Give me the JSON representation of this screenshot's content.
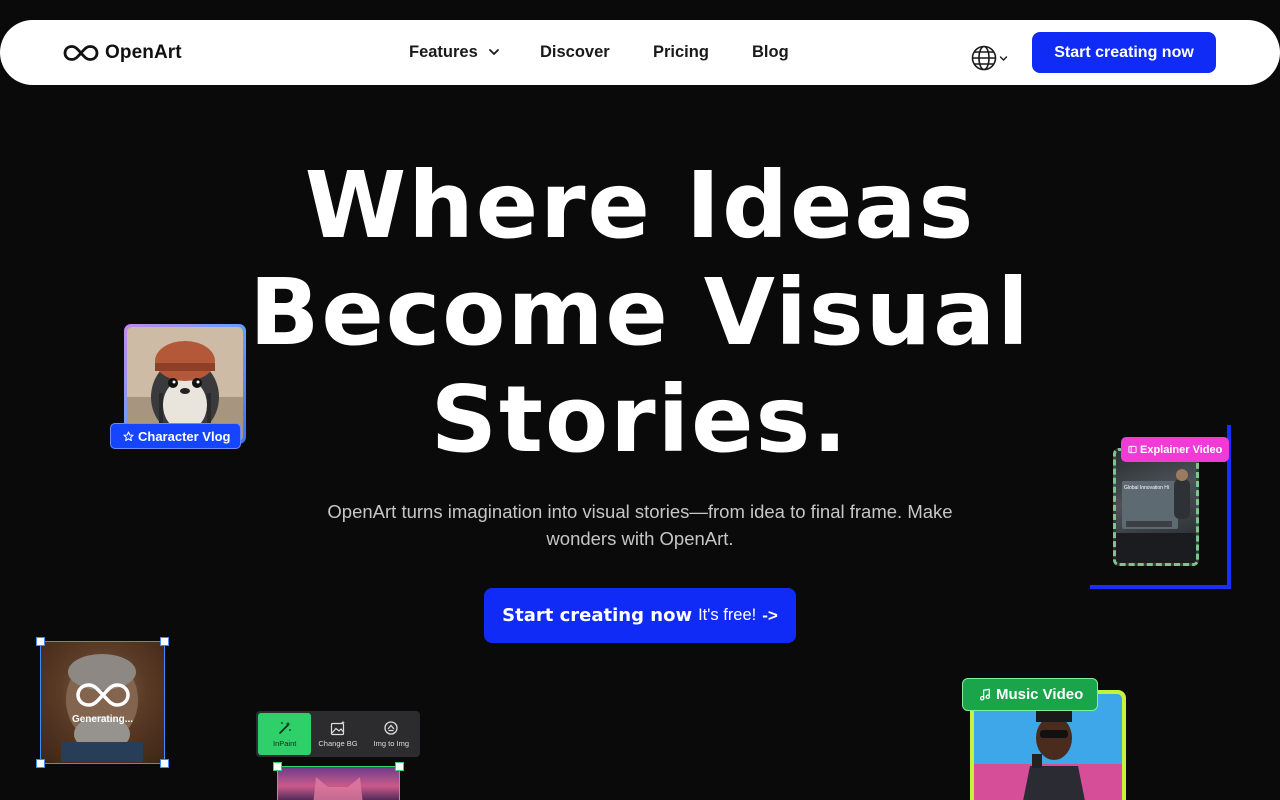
{
  "brand": {
    "name": "OpenArt"
  },
  "nav": {
    "links": [
      {
        "label": "Features",
        "has_dropdown": true
      },
      {
        "label": "Discover"
      },
      {
        "label": "Pricing"
      },
      {
        "label": "Blog"
      }
    ],
    "language_icon": "globe-icon",
    "cta_label": "Start creating now"
  },
  "hero": {
    "title_lines": [
      "Where Ideas",
      "Become Visual",
      "Stories."
    ],
    "subtitle": "OpenArt turns imagination into visual stories—from idea to final frame. Make wonders with OpenArt.",
    "cta": {
      "main": "Start creating now",
      "free": "It's free!",
      "arrow": "->"
    }
  },
  "cards": {
    "character_vlog": {
      "label": "Character Vlog",
      "icon": "star-icon"
    },
    "explainer_video": {
      "label": "Explainer Video",
      "icon": "video-icon",
      "screen_text": "Global Innovation Hi"
    },
    "generating": {
      "label": "Generating..."
    },
    "toolbar": {
      "tools": [
        {
          "label": "InPaint",
          "icon": "magic-wand-icon",
          "active": true
        },
        {
          "label": "Change BG",
          "icon": "image-sparkle-icon",
          "active": false
        },
        {
          "label": "Img to Img",
          "icon": "swap-circle-icon",
          "active": false
        }
      ]
    },
    "music_video": {
      "label": "Music Video",
      "icon": "music-note-icon"
    }
  },
  "colors": {
    "background": "#0a0a0b",
    "accent": "#0f2bf5",
    "nav_bg": "#ffffff",
    "badge_vlog": "#1645ff",
    "badge_explainer": "#f03bd6",
    "badge_music": "#1ba54b",
    "music_frame": "#c6f23a",
    "tool_active": "#2fcf6a"
  }
}
